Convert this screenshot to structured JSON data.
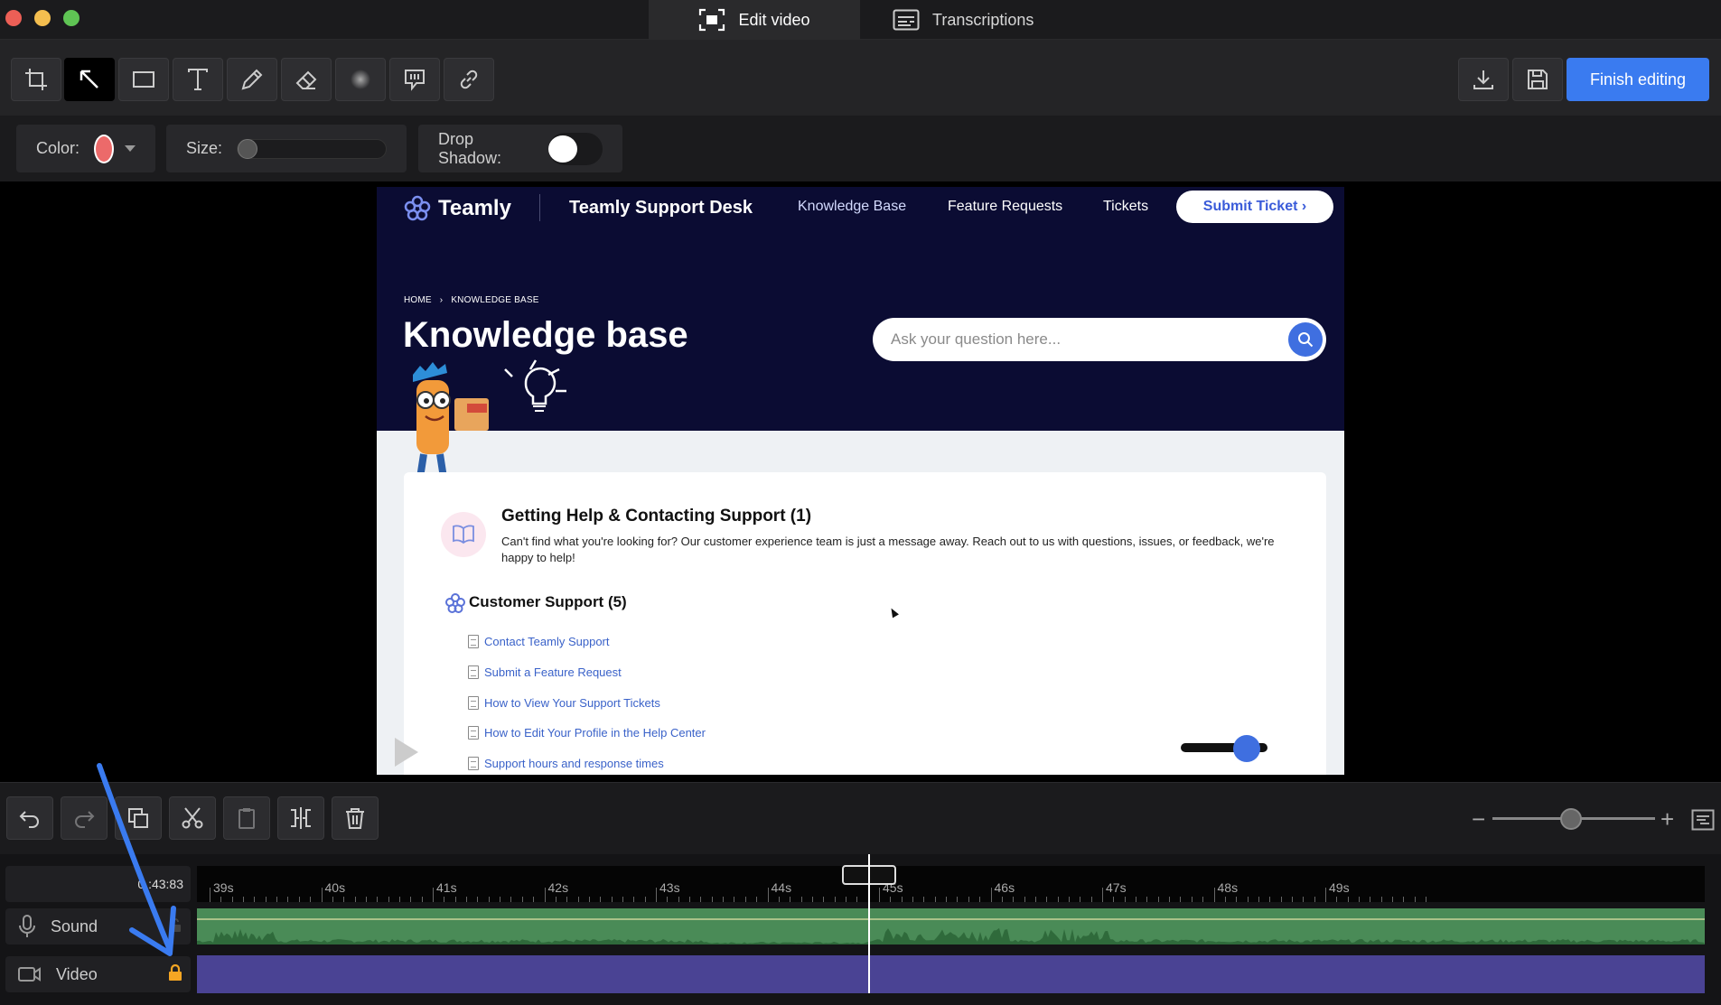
{
  "window": {
    "tabs": [
      {
        "label": "Edit video",
        "active": true,
        "icon": "screen-select-icon"
      },
      {
        "label": "Transcriptions",
        "active": false,
        "icon": "subtitles-icon"
      }
    ]
  },
  "toolbar": {
    "tools": [
      "crop-icon",
      "arrow-icon",
      "rectangle-icon",
      "text-icon",
      "pen-icon",
      "eraser-icon",
      "blur-icon",
      "callout-icon",
      "link-icon"
    ],
    "active_tool": "arrow-icon",
    "finish_label": "Finish editing"
  },
  "options": {
    "color_label": "Color:",
    "color_value": "#ec6a6a",
    "size_label": "Size:",
    "size_value": 0,
    "shadow_label": "Drop Shadow:",
    "shadow_on": false
  },
  "preview": {
    "brand": "Teamly",
    "desk": "Teamly Support Desk",
    "nav": [
      "Knowledge Base",
      "Feature Requests",
      "Tickets"
    ],
    "submit": "Submit Ticket ›",
    "breadcrumb_home": "HOME",
    "breadcrumb_sep": "›",
    "breadcrumb_current": "KNOWLEDGE BASE",
    "title": "Knowledge base",
    "search_placeholder": "Ask your question here...",
    "section_title": "Getting Help & Contacting Support (1)",
    "section_desc": "Can't find what you're looking for? Our customer experience team is just a message away. Reach out to us with questions, issues, or feedback, we're happy to help!",
    "subsection_title": "Customer Support (5)",
    "articles": [
      "Contact Teamly Support",
      "Submit a Feature Request",
      "How to View Your Support Tickets",
      "How to Edit Your Profile in the Help Center",
      "Support hours and response times"
    ]
  },
  "editbar": {
    "tools": [
      "undo-icon",
      "redo-icon",
      "duplicate-icon",
      "cut-icon",
      "paste-icon",
      "split-icon",
      "delete-icon"
    ]
  },
  "timeline": {
    "timecode": "0 :43:83",
    "ticks": [
      "39s",
      "40s",
      "41s",
      "42s",
      "43s",
      "44s",
      "45s",
      "46s",
      "47s",
      "48s",
      "49s"
    ],
    "tracks": [
      {
        "label": "Sound",
        "icon": "microphone-icon",
        "locked": false
      },
      {
        "label": "Video",
        "icon": "camera-icon",
        "locked": true
      }
    ]
  },
  "colors": {
    "accent": "#3a7bf0",
    "sound_track": "#4a8b57",
    "video_track": "#4a4394",
    "hero_bg": "#0b0c33",
    "lock": "#f5a623",
    "annotation_arrow": "#3a7bf0"
  }
}
